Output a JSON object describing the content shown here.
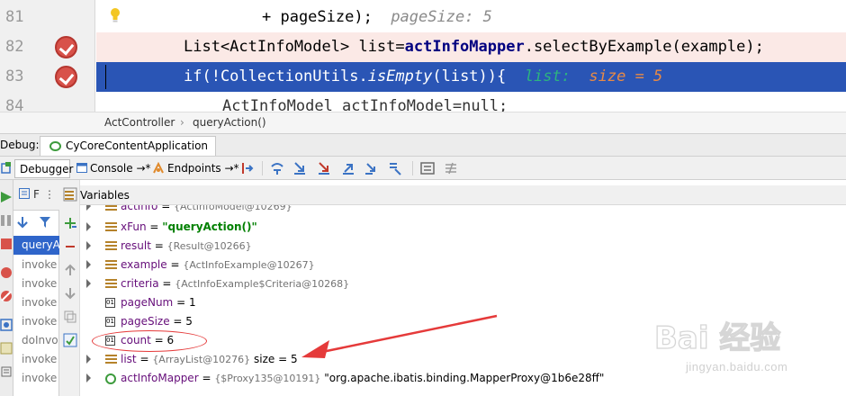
{
  "editor": {
    "lines": [
      {
        "num": "81",
        "code": "+ pageSize);",
        "hint": "pageSize: 5",
        "breakpoint": false,
        "current": false
      },
      {
        "num": "82",
        "code_pre": "List<ActInfoModel> list=",
        "code_bold": "actInfoMapper",
        "code_post": ".selectByExample(example);",
        "breakpoint": true,
        "current": false
      },
      {
        "num": "83",
        "code_pre": "if(!CollectionUtils.",
        "code_italic": "isEmpty",
        "code_post": "(list)){",
        "hint_name": "list:",
        "hint_value": "size = 5",
        "breakpoint": true,
        "current": true
      },
      {
        "num": "84",
        "code": "ActInfoModel actInfoModel=null;",
        "breakpoint": false,
        "current": false
      }
    ]
  },
  "breadcrumb": {
    "class_name": "ActController",
    "separator": "›",
    "method_name": "queryAction()"
  },
  "debug": {
    "label": "Debug:",
    "session_tab": "CyCoreContentApplication"
  },
  "toolbar": {
    "tabs": [
      {
        "label": "Debugger"
      },
      {
        "label": "Console →*"
      },
      {
        "label": "Endpoints →*"
      }
    ]
  },
  "frames": {
    "header": "F",
    "items": [
      "queryA",
      "invoke",
      "invoke",
      "invoke",
      "invoke",
      "doInvo",
      "invoke",
      "invoke"
    ]
  },
  "variables": {
    "title": "Variables",
    "rows": [
      {
        "name": "actInfo",
        "eq": " = ",
        "ref": "{ActInfoModel@10269}",
        "expandable": true,
        "icon": "obj"
      },
      {
        "name": "xFun",
        "eq": " = ",
        "str": "\"queryAction()\"",
        "expandable": true,
        "icon": "obj"
      },
      {
        "name": "result",
        "eq": " = ",
        "ref": "{Result@10266}",
        "expandable": true,
        "icon": "obj"
      },
      {
        "name": "example",
        "eq": " = ",
        "ref": "{ActInfoExample@10267}",
        "expandable": true,
        "icon": "obj"
      },
      {
        "name": "criteria",
        "eq": " = ",
        "ref": "{ActInfoExample$Criteria@10268}",
        "expandable": true,
        "icon": "obj"
      },
      {
        "name": "pageNum",
        "eq": " = ",
        "plain": "1",
        "expandable": false,
        "icon": "prim"
      },
      {
        "name": "pageSize",
        "eq": " = ",
        "plain": "5",
        "expandable": false,
        "icon": "prim"
      },
      {
        "name": "count",
        "eq": " = ",
        "plain": "6",
        "expandable": false,
        "icon": "prim"
      },
      {
        "name": "list",
        "eq": " = ",
        "ref": "{ArrayList@10276}",
        "plain": "size = 5",
        "expandable": true,
        "icon": "obj"
      },
      {
        "name": "actInfoMapper",
        "eq": " = ",
        "ref": "{$Proxy135@10191}",
        "plain": "\"org.apache.ibatis.binding.MapperProxy@1b6e28ff\"",
        "expandable": true,
        "icon": "proxy"
      }
    ]
  },
  "watermark": {
    "logo": "Bai 经验",
    "url": "jingyan.baidu.com"
  },
  "colors": {
    "current_line": "#2a55b5",
    "breakpoint": "#d8524a",
    "annotation": "#e53a3a",
    "frame_selected": "#2f65ca"
  }
}
